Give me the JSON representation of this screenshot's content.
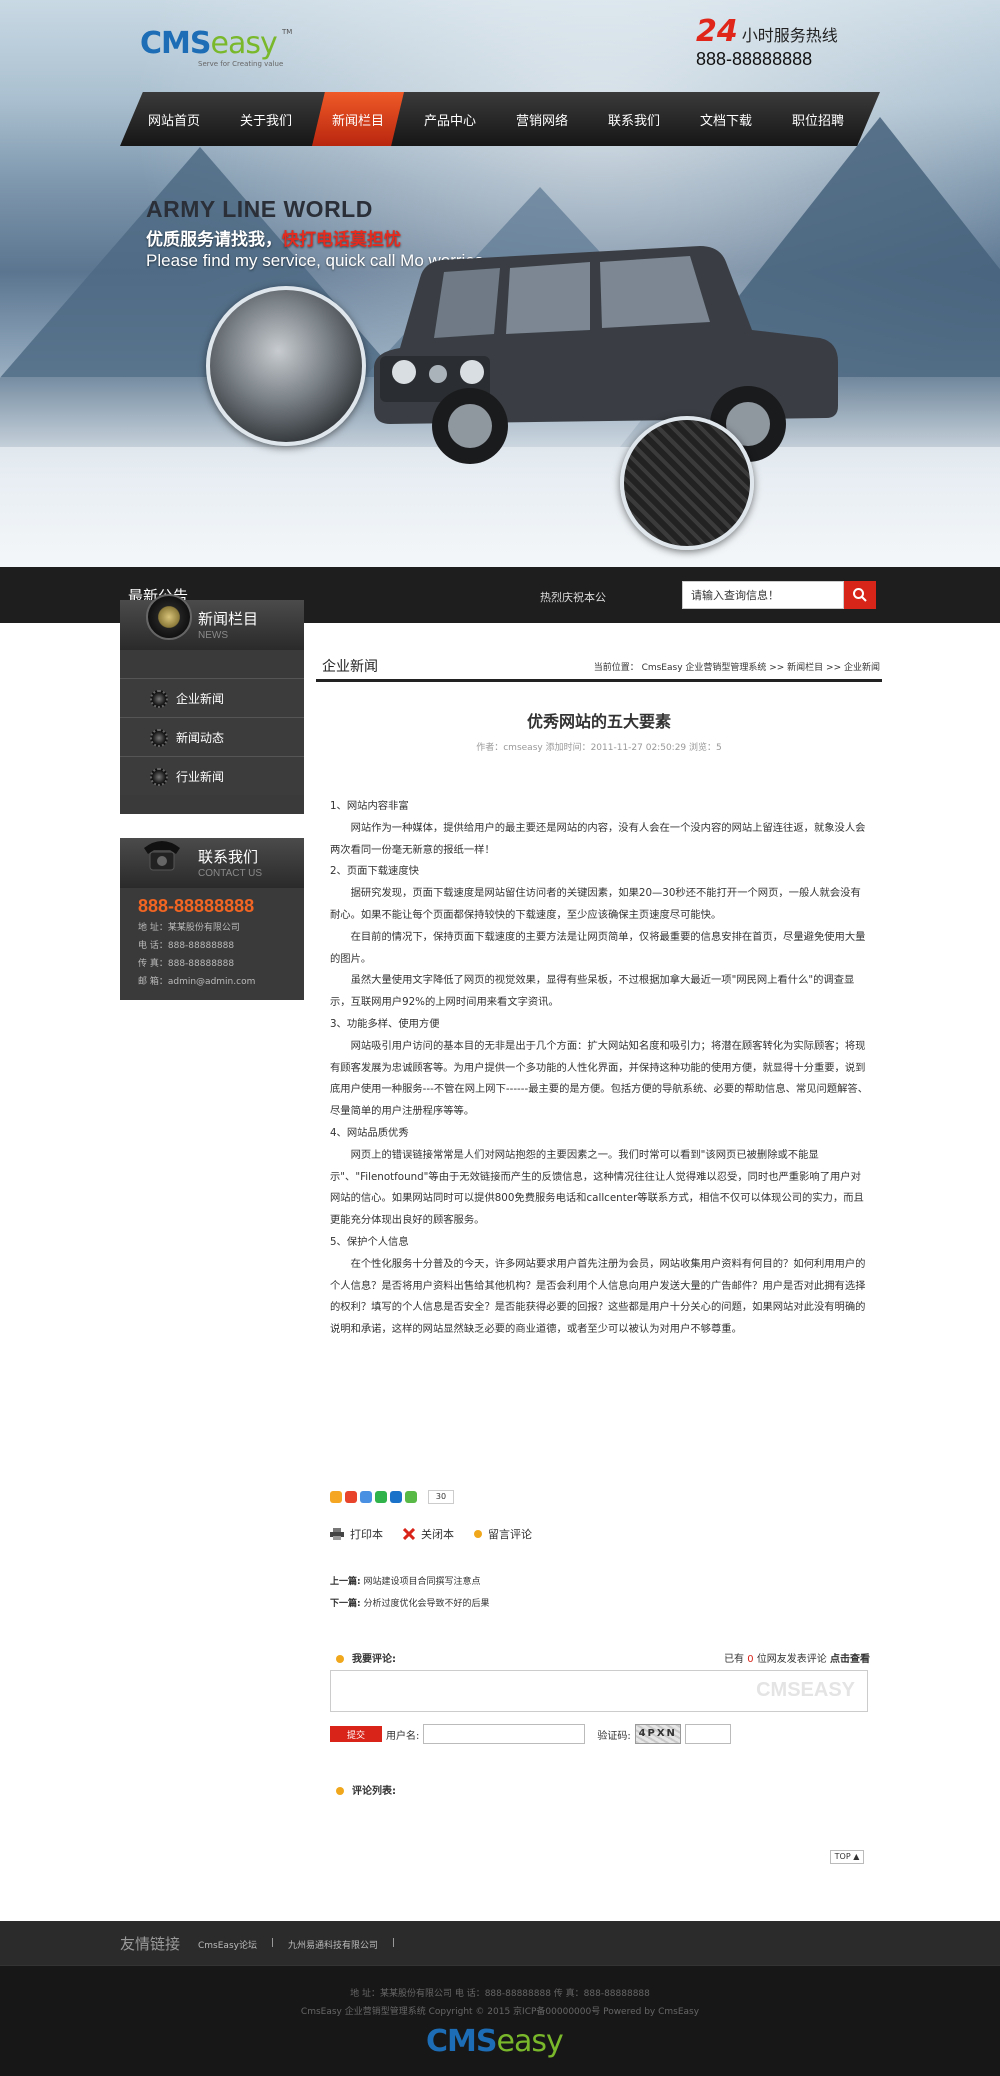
{
  "header": {
    "logo_main": "CMS",
    "logo_accent": "easy",
    "logo_tagline": "Serve for Creating value",
    "logo_tm": "TM",
    "hotline_num": "24",
    "hotline_label": "小时服务热线",
    "hotline_phone": "888-88888888"
  },
  "nav": {
    "items": [
      "网站首页",
      "关于我们",
      "新闻栏目",
      "产品中心",
      "营销网络",
      "联系我们",
      "文档下载",
      "职位招聘"
    ],
    "active_index": 2
  },
  "banner": {
    "title": "ARMY LINE WORLD",
    "sub_pre": "优质服务请找我，",
    "sub_highlight": "快打电话莫担忧",
    "sub_en": "Please find my service, quick call Mo worries."
  },
  "notice": {
    "title": "最新公告",
    "text": "热烈庆祝本公",
    "search_placeholder": "请输入查询信息！"
  },
  "sidebar": {
    "news_title": "新闻栏目",
    "news_sub": "NEWS",
    "news_items": [
      "企业新闻",
      "新闻动态",
      "行业新闻"
    ],
    "contact_title": "联系我们",
    "contact_sub": "CONTACT US",
    "contact_phone": "888-88888888",
    "contact_lines": [
      "地  址：某某股份有限公司",
      "电  话：888-88888888",
      "传  真：888-88888888",
      "邮  箱：admin@admin.com"
    ]
  },
  "main": {
    "section_title": "企业新闻",
    "breadcrumb": "当前位置： CmsEasy 企业营销型管理系统  >>  新闻栏目  >>  企业新闻",
    "article_title": "优秀网站的五大要素",
    "article_meta": "作者：cmseasy   添加时间：2011-11-27 02:50:29   浏览：5",
    "paragraphs": [
      {
        "text": "1、网站内容非富",
        "indent": false
      },
      {
        "text": "网站作为一种媒体，提供给用户的最主要还是网站的内容，没有人会在一个没内容的网站上留连往返，就象没人会两次看同一份毫无新意的报纸一样！",
        "indent": true
      },
      {
        "text": "2、页面下载速度快",
        "indent": false
      },
      {
        "text": "据研究发现，页面下载速度是网站留住访问者的关键因素，如果20—30秒还不能打开一个网页，一般人就会没有耐心。如果不能让每个页面都保持较快的下载速度，至少应该确保主页速度尽可能快。",
        "indent": true
      },
      {
        "text": "在目前的情况下，保持页面下载速度的主要方法是让网页简单，仅将最重要的信息安排在首页，尽量避免使用大量的图片。",
        "indent": true
      },
      {
        "text": "虽然大量使用文字降低了网页的视觉效果，显得有些呆板，不过根据加拿大最近一项\"网民网上看什么\"的调查显示，互联网用户92%的上网时间用来看文字资讯。",
        "indent": true
      },
      {
        "text": "3、功能多样、使用方便",
        "indent": false
      },
      {
        "text": "网站吸引用户访问的基本目的无非是出于几个方面：扩大网站知名度和吸引力；将潜在顾客转化为实际顾客；将现有顾客发展为忠诚顾客等。为用户提供一个多功能的人性化界面，并保持这种功能的使用方便，就显得十分重要，说到底用户使用一种服务---不管在网上网下------最主要的是方便。包括方便的导航系统、必要的帮助信息、常见问题解答、尽量简单的用户注册程序等等。",
        "indent": true
      },
      {
        "text": "4、网站品质优秀",
        "indent": false
      },
      {
        "text": "网页上的错误链接常常是人们对网站抱怨的主要因素之一。我们时常可以看到\"该网页已被删除或不能显示\"、\"Filenotfound\"等由于无效链接而产生的反馈信息，这种情况往往让人觉得难以忍受，同时也严重影响了用户对网站的信心。如果网站同时可以提供800免费服务电话和callcenter等联系方式，相信不仅可以体现公司的实力，而且更能充分体现出良好的顾客服务。",
        "indent": true
      },
      {
        "text": "5、保护个人信息",
        "indent": false
      },
      {
        "text": "在个性化服务十分普及的今天，许多网站要求用户首先注册为会员，网站收集用户资料有何目的？如何利用用户的个人信息？是否将用户资料出售给其他机构？是否会利用个人信息向用户发送大量的广告邮件？用户是否对此拥有选择的权利？填写的个人信息是否安全？是否能获得必要的回报？这些都是用户十分关心的问题，如果网站对此没有明确的说明和承诺，这样的网站显然缺乏必要的商业道德，或者至少可以被认为对用户不够尊重。",
        "indent": true
      }
    ],
    "share_count": "30",
    "tools": [
      "打印本",
      "关闭本",
      "留言评论"
    ],
    "prev_label": "上一篇:",
    "prev_title": "网站建设项目合同撰写注意点",
    "next_label": "下一篇:",
    "next_title": "分析过度优化会导致不好的后果",
    "comment_label": "我要评论:",
    "comment_count_pre": "已有",
    "comment_count": "0",
    "comment_count_post": "位网友发表评论",
    "comment_view": "点击查看",
    "comment_watermark": "CMSEASY",
    "submit_label": "提交",
    "username_label": "用户名:",
    "captcha_label": "验证码:",
    "captcha_text": "4PXN",
    "comment_list_label": "评论列表:",
    "top_label": "TOP"
  },
  "footer": {
    "links_title": "友情链接",
    "links": [
      "CmsEasy论坛",
      "|",
      "九州易通科技有限公司",
      "|"
    ],
    "line1": "地 址：某某股份有限公司   电 话：888-88888888   传 真：888-88888888",
    "line2": "CmsEasy 企业营销型管理系统 Copyright © 2015 京ICP备00000000号 Powered by CmsEasy",
    "logo_main": "CMS",
    "logo_accent": "easy"
  },
  "colors": {
    "accent_red": "#d9241a",
    "accent_orange": "#f26522",
    "brand_blue": "#1c6db5",
    "brand_green": "#7ab82b"
  }
}
